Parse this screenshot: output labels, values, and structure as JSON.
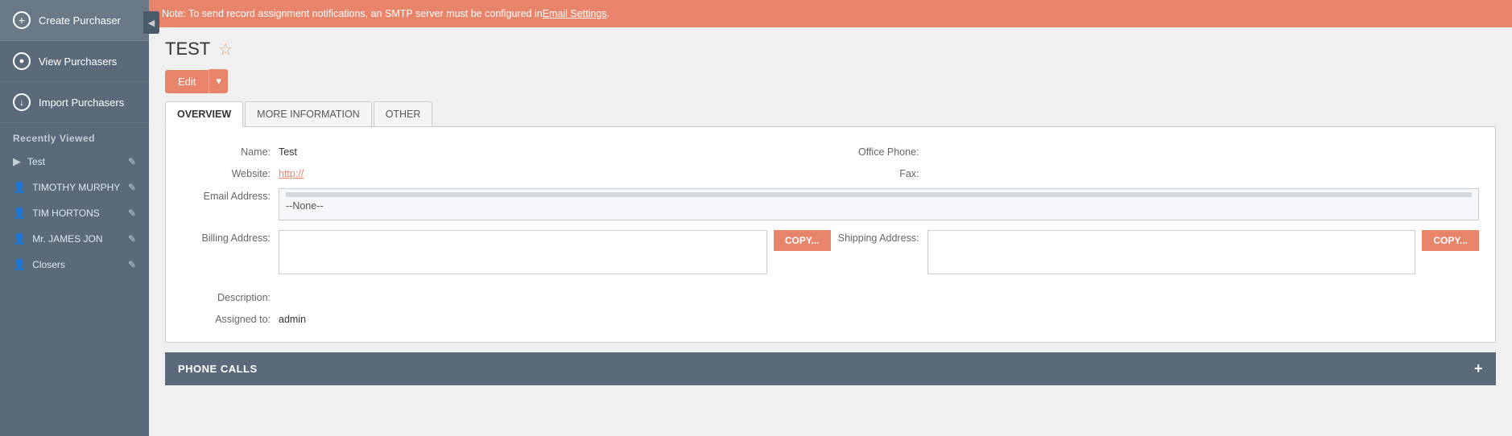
{
  "sidebar": {
    "items": [
      {
        "id": "create-purchaser",
        "label": "Create Purchaser",
        "icon": "+"
      },
      {
        "id": "view-purchasers",
        "label": "View Purchasers",
        "icon": "👁"
      },
      {
        "id": "import-purchasers",
        "label": "Import Purchasers",
        "icon": "↓"
      }
    ],
    "section_title": "Recently Viewed",
    "recent_items": [
      {
        "id": "test",
        "label": "Test"
      },
      {
        "id": "timothy-murphy",
        "label": "TIMOTHY MURPHY"
      },
      {
        "id": "tim-hortons",
        "label": "TIM HORTONS"
      },
      {
        "id": "mr-james-jon",
        "label": "Mr. JAMES JON"
      },
      {
        "id": "closers",
        "label": "Closers"
      }
    ]
  },
  "alert": {
    "text": "Note: To send record assignment notifications, an SMTP server must be configured in ",
    "link": "Email Settings",
    "suffix": "."
  },
  "page": {
    "title": "TEST",
    "star_label": "☆"
  },
  "edit_button": {
    "label": "Edit",
    "dropdown_icon": "▾"
  },
  "tabs": [
    {
      "id": "overview",
      "label": "OVERVIEW",
      "active": true
    },
    {
      "id": "more-information",
      "label": "MORE INFORMATION",
      "active": false
    },
    {
      "id": "other",
      "label": "OTHER",
      "active": false
    }
  ],
  "form": {
    "name_label": "Name:",
    "name_value": "Test",
    "office_phone_label": "Office Phone:",
    "office_phone_value": "",
    "website_label": "Website:",
    "website_value": "http://",
    "fax_label": "Fax:",
    "fax_value": "",
    "email_label": "Email Address:",
    "email_value": "--None--",
    "billing_label": "Billing Address:",
    "copy_billing": "COPY...",
    "shipping_label": "Shipping Address:",
    "copy_shipping": "COPY...",
    "description_label": "Description:",
    "description_value": "",
    "assigned_label": "Assigned to:",
    "assigned_value": "admin"
  },
  "phone_calls": {
    "title": "PHONE CALLS",
    "plus": "+"
  },
  "colors": {
    "sidebar_bg": "#5a6a7a",
    "accent": "#e8846a",
    "alert_bg": "#e8846a"
  }
}
